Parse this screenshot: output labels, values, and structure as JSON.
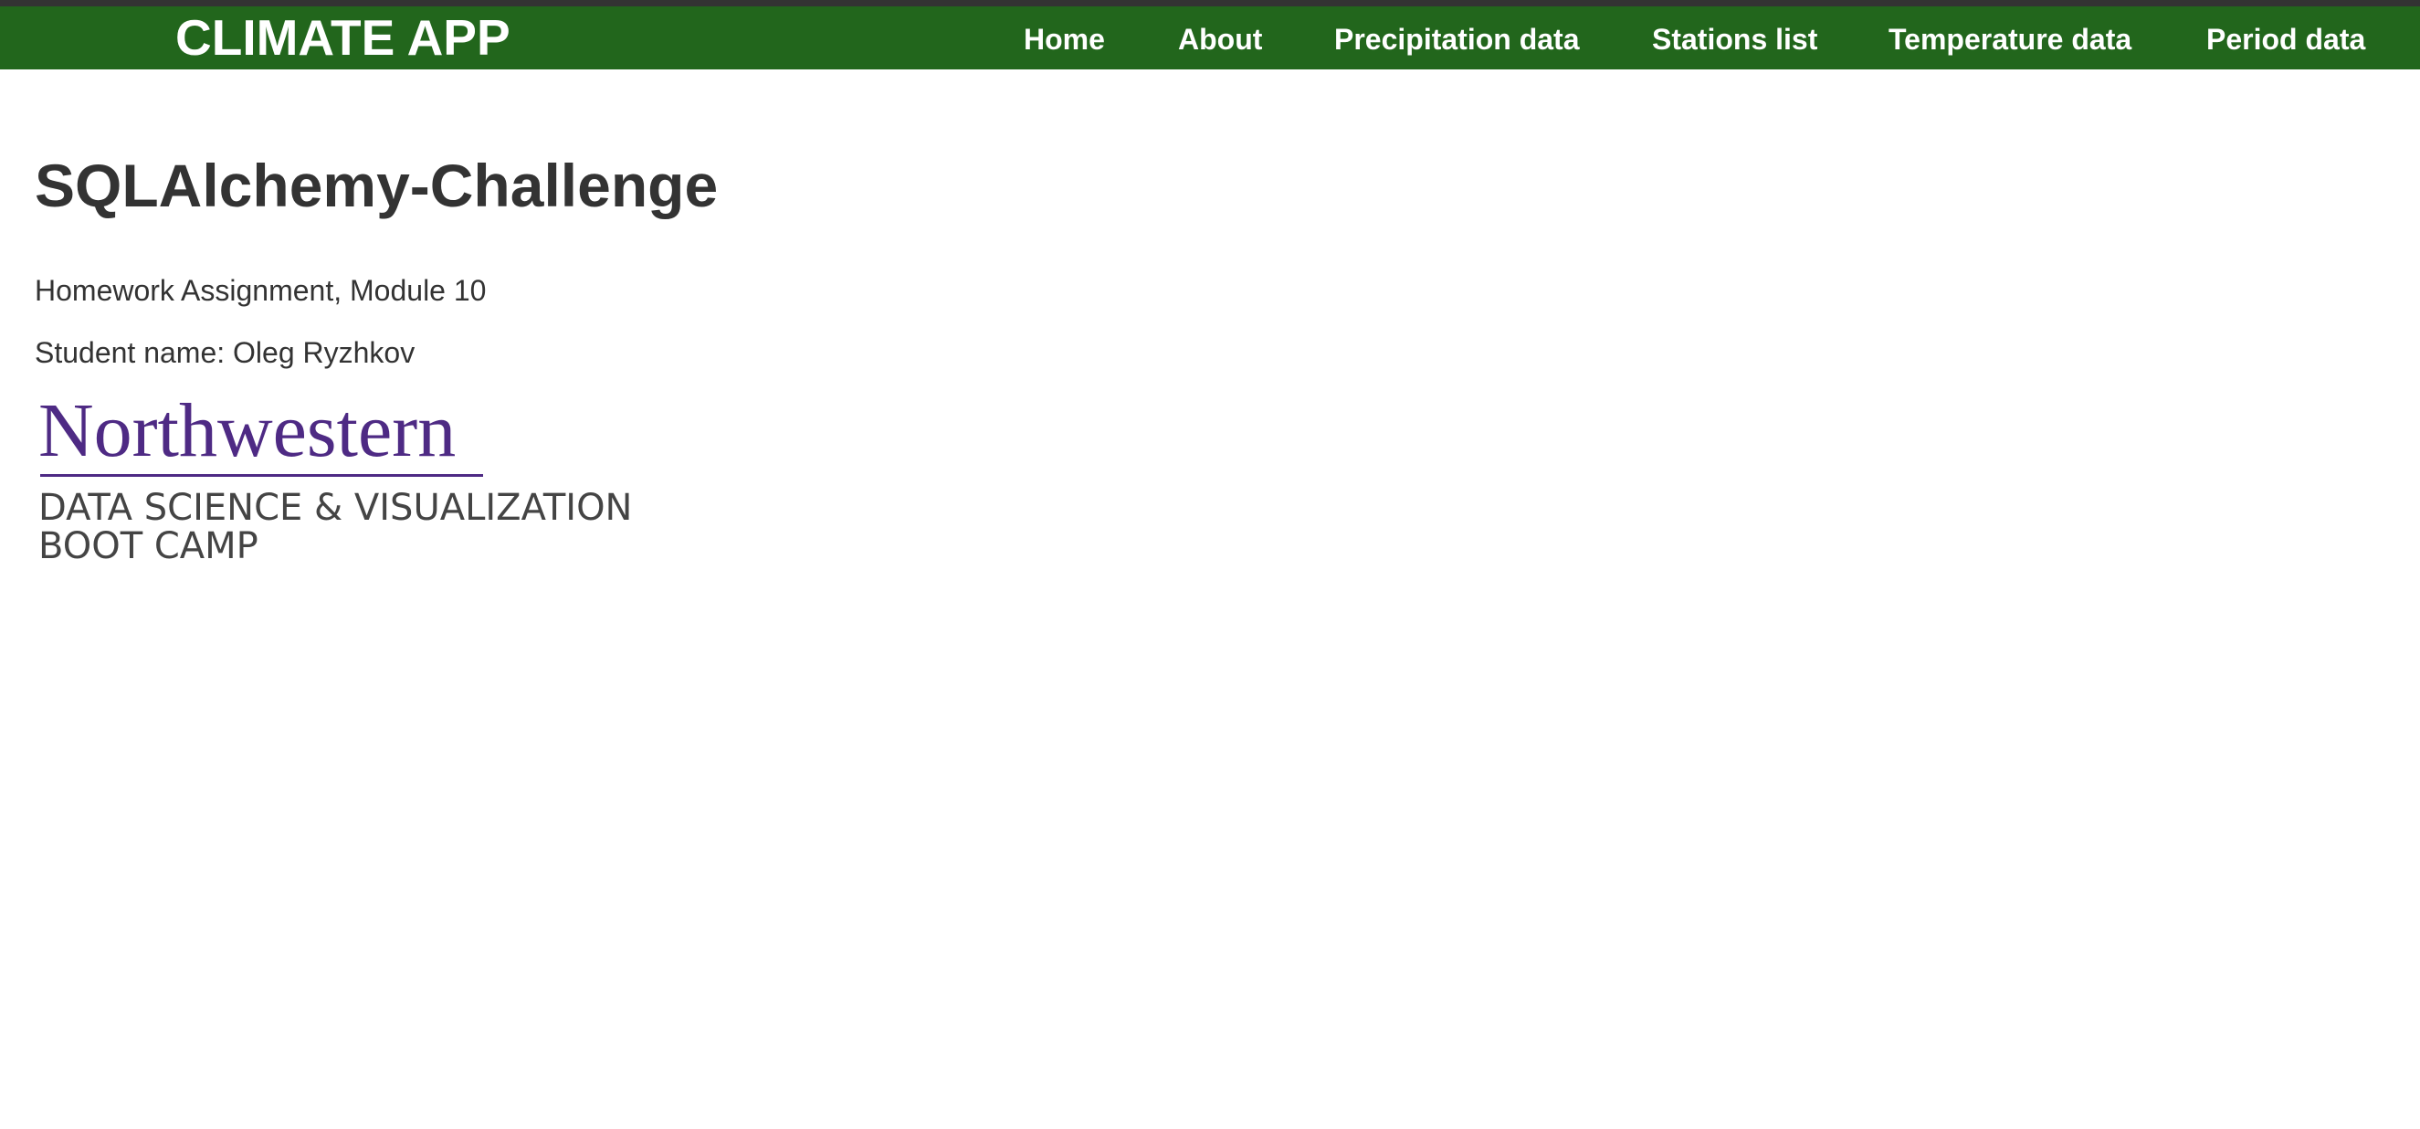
{
  "navbar": {
    "brand": "CLIMATE APP",
    "links": [
      {
        "label": "Home"
      },
      {
        "label": "About"
      },
      {
        "label": "Precipitation data"
      },
      {
        "label": "Stations list"
      },
      {
        "label": "Temperature data"
      },
      {
        "label": "Period data"
      }
    ],
    "color": "#22661c"
  },
  "main": {
    "title": "SQLAlchemy-Challenge",
    "subtitle": "Homework Assignment, Module 10",
    "student": "Student name: Oleg Ryzhkov"
  },
  "logo": {
    "wordmark": "Northwestern",
    "line1": "DATA SCIENCE & VISUALIZATION",
    "line2": "BOOT CAMP",
    "color": "#4e2a84"
  }
}
